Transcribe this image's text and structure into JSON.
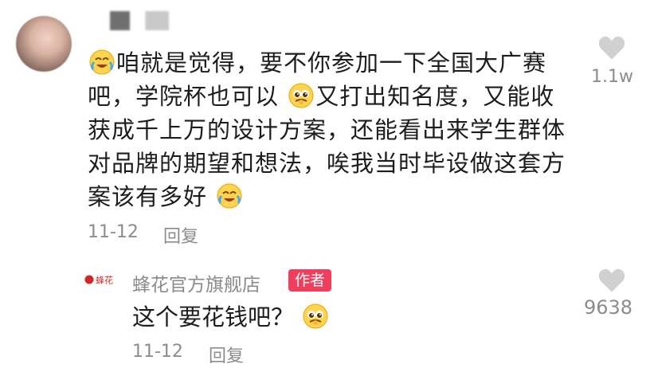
{
  "comment": {
    "text_lines": [
      "咱就是觉得，要不你参加一下全国大广赛",
      "吧，学院杯也可以",
      "又打出知名度，又能收",
      "获成千上万的设计方案，还能看出来学生群体",
      "对品牌的期望和想法，唉我当时毕设做这套方",
      "案该有多好"
    ],
    "date": "11-12",
    "reply_label": "回复",
    "likes": "1.1w",
    "emoji_names": [
      "crying-laugh-emoji",
      "pleading-emoji",
      "crying-laugh-emoji"
    ]
  },
  "reply": {
    "shop_name": "蜂花官方旗舰店",
    "badge": "作者",
    "brand_logo_text": "蜂花",
    "text": "这个要花钱吧？",
    "date": "11-12",
    "reply_label": "回复",
    "likes": "9638",
    "emoji_name": "pleading-emoji"
  },
  "colors": {
    "text": "#1d1d1d",
    "meta": "#8c8c8c",
    "badge": "#ef3f5d",
    "heart": "#d0d0d0"
  }
}
